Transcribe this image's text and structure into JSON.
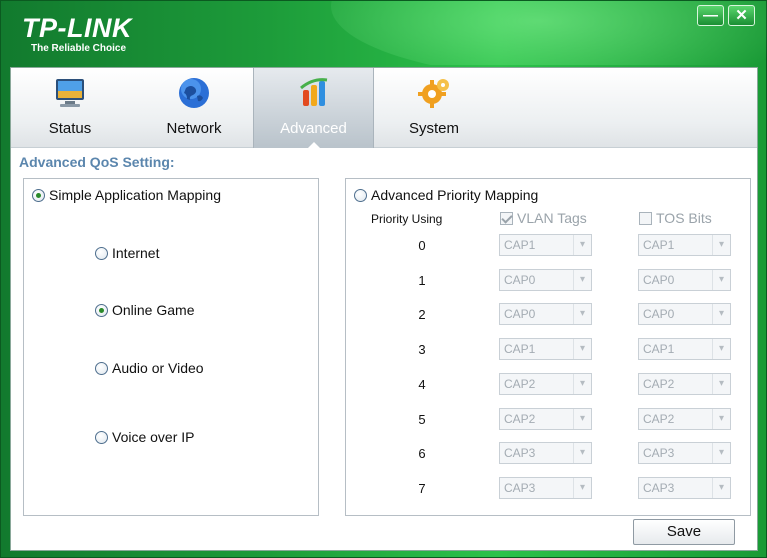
{
  "brand": {
    "name": "TP-LINK",
    "tagline": "The Reliable Choice"
  },
  "window_controls": {
    "minimize": "—",
    "close": "✕"
  },
  "tabs": [
    {
      "label": "Status",
      "icon": "monitor-icon"
    },
    {
      "label": "Network",
      "icon": "globe-icon"
    },
    {
      "label": "Advanced",
      "icon": "advanced-chart-icon",
      "selected": true
    },
    {
      "label": "System",
      "icon": "gear-icon"
    }
  ],
  "section_title": "Advanced QoS Setting:",
  "simple_mapping": {
    "label": "Simple Application Mapping",
    "selected": true,
    "options": [
      {
        "label": "Internet",
        "selected": false
      },
      {
        "label": "Online Game",
        "selected": true
      },
      {
        "label": "Audio or Video",
        "selected": false
      },
      {
        "label": "Voice over IP",
        "selected": false
      }
    ]
  },
  "advanced_mapping": {
    "label": "Advanced Priority Mapping",
    "selected": false,
    "priority_using_label": "Priority Using",
    "vlan_tags": {
      "label": "VLAN Tags",
      "checked": true
    },
    "tos_bits": {
      "label": "TOS Bits",
      "checked": false
    },
    "rows": [
      {
        "priority": "0",
        "vlan": "CAP1",
        "tos": "CAP1"
      },
      {
        "priority": "1",
        "vlan": "CAP0",
        "tos": "CAP0"
      },
      {
        "priority": "2",
        "vlan": "CAP0",
        "tos": "CAP0"
      },
      {
        "priority": "3",
        "vlan": "CAP1",
        "tos": "CAP1"
      },
      {
        "priority": "4",
        "vlan": "CAP2",
        "tos": "CAP2"
      },
      {
        "priority": "5",
        "vlan": "CAP2",
        "tos": "CAP2"
      },
      {
        "priority": "6",
        "vlan": "CAP3",
        "tos": "CAP3"
      },
      {
        "priority": "7",
        "vlan": "CAP3",
        "tos": "CAP3"
      }
    ]
  },
  "save_label": "Save",
  "colors": {
    "title_bar": "#1d9c3a",
    "section_title": "#5b86ad",
    "radio_dot": "#2a8a2a"
  }
}
